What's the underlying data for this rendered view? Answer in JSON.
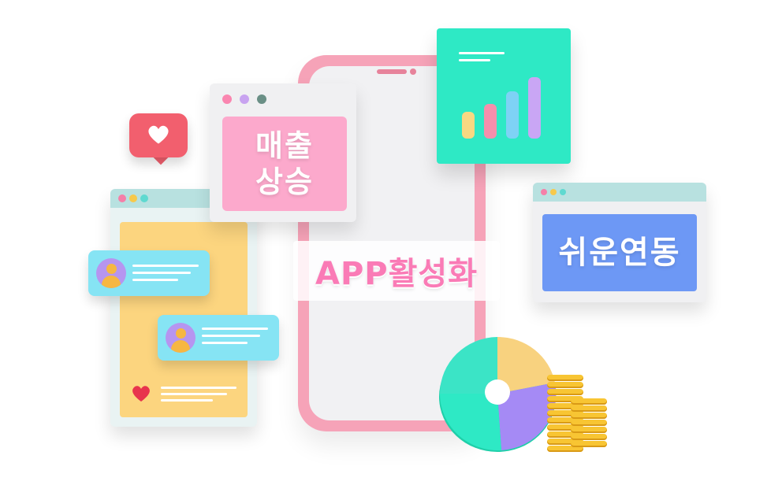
{
  "labels": {
    "sales_line1": "매출",
    "sales_line2": "상승",
    "easy_link": "쉬운연동",
    "app_activation": "APP활성화"
  },
  "colors": {
    "phone": "#f6a3b8",
    "sales_card": "#fca9cc",
    "chart_card": "#2ee9c5",
    "blue_card": "#6d98f5",
    "chat_bubble": "#86e4f4",
    "left_panel": "#fcd57f",
    "heart": "#f25f6e"
  },
  "icons": [
    "heart-icon",
    "avatar-icon",
    "bar-chart-icon",
    "pie-chart-icon",
    "coin-stack-icon"
  ]
}
